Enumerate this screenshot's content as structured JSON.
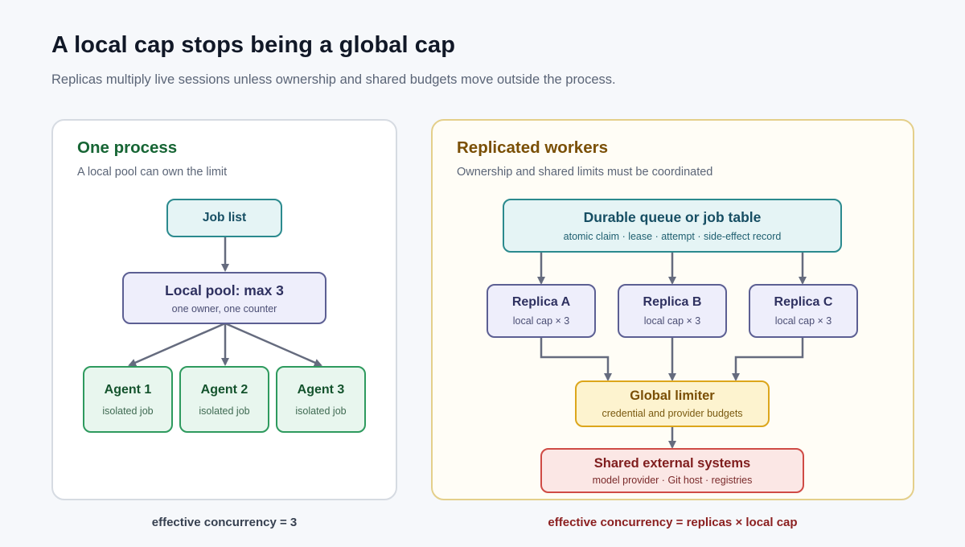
{
  "header": {
    "title": "A local cap stops being a global cap",
    "subtitle": "Replicas multiply live sessions unless ownership and shared budgets move outside the process."
  },
  "left_panel": {
    "title": "One process",
    "subtitle": "A local pool can own the limit",
    "job_list": {
      "title": "Job list"
    },
    "pool": {
      "title": "Local pool: max 3",
      "subtitle": "one owner, one counter"
    },
    "agents": [
      {
        "title": "Agent 1",
        "subtitle": "isolated job"
      },
      {
        "title": "Agent 2",
        "subtitle": "isolated job"
      },
      {
        "title": "Agent 3",
        "subtitle": "isolated job"
      }
    ],
    "footer": "effective concurrency = 3"
  },
  "right_panel": {
    "title": "Replicated workers",
    "subtitle": "Ownership and shared limits must be coordinated",
    "queue": {
      "title": "Durable queue or job table",
      "subtitle": "atomic claim · lease · attempt · side-effect record"
    },
    "replicas": [
      {
        "title": "Replica A",
        "subtitle": "local cap × 3"
      },
      {
        "title": "Replica B",
        "subtitle": "local cap × 3"
      },
      {
        "title": "Replica C",
        "subtitle": "local cap × 3"
      }
    ],
    "limiter": {
      "title": "Global limiter",
      "subtitle": "credential and provider budgets"
    },
    "external": {
      "title": "Shared external systems",
      "subtitle": "model provider · Git host · registries"
    },
    "footer": "effective concurrency = replicas × local cap"
  },
  "colors": {
    "connector": "#656b7e",
    "teal_border": "#2b8a8e",
    "purple_border": "#5c5f93",
    "green_border": "#2e9a5e",
    "yellow_border": "#dca61c",
    "red_border": "#cf4b45",
    "right_footer": "#8b1f1f"
  }
}
